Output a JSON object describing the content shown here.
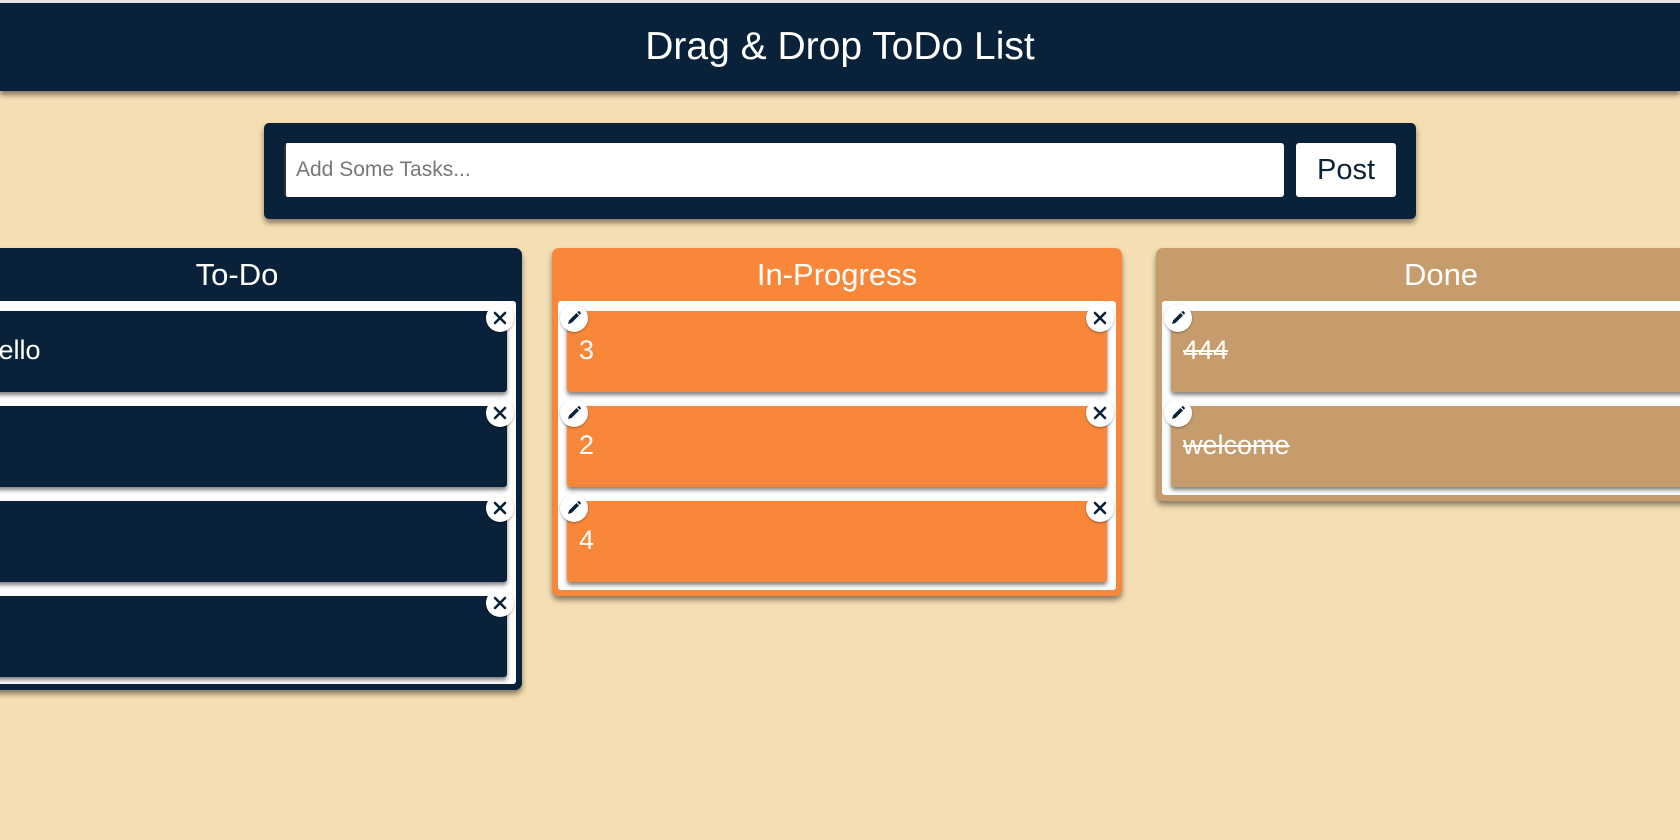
{
  "header": {
    "title": "Drag & Drop ToDo List"
  },
  "form": {
    "placeholder": "Add Some Tasks...",
    "post_label": "Post"
  },
  "columns": {
    "todo": {
      "title": "To-Do",
      "cards": [
        "Hello",
        "",
        "",
        ""
      ]
    },
    "progress": {
      "title": "In-Progress",
      "cards": [
        "3",
        "2",
        "4"
      ]
    },
    "done": {
      "title": "Done",
      "cards": [
        "444",
        "welcome"
      ]
    }
  },
  "icons": {
    "delete": "close-icon",
    "edit": "pencil-icon"
  },
  "colors": {
    "background": "#f5deb3",
    "navy": "#0a2239",
    "orange": "#f9873a",
    "tan": "#c69c6d"
  }
}
